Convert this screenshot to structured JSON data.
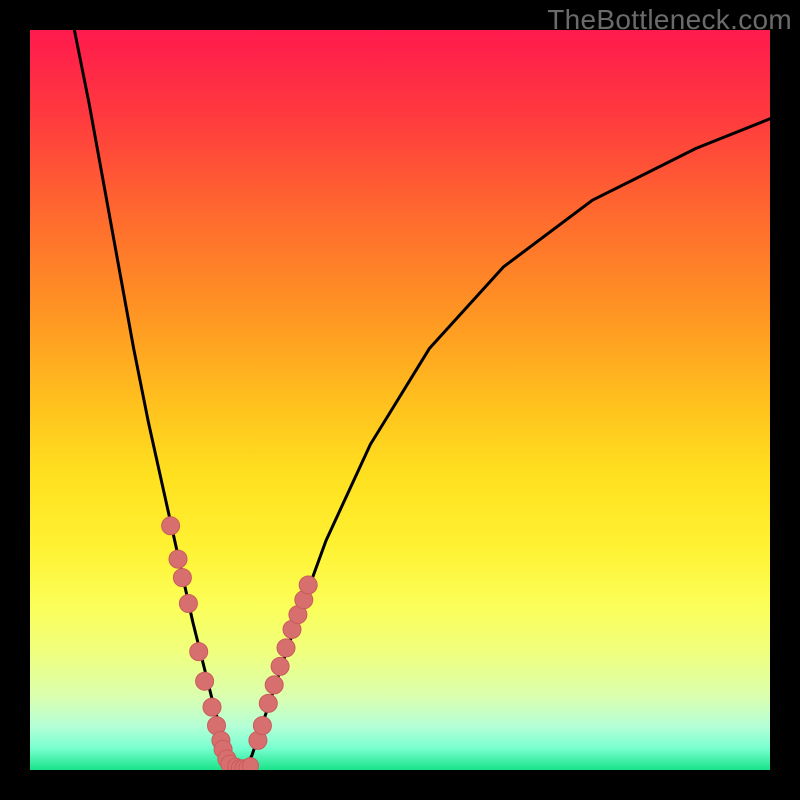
{
  "watermark": "TheBottleneck.com",
  "chart_data": {
    "type": "line",
    "title": "",
    "xlabel": "",
    "ylabel": "",
    "xlim": [
      0,
      100
    ],
    "ylim": [
      0,
      100
    ],
    "curve": {
      "x": [
        6,
        8,
        10,
        12,
        14,
        16,
        18,
        20,
        22,
        23,
        24,
        25,
        26,
        27,
        28,
        29,
        30,
        31,
        33,
        36,
        40,
        46,
        54,
        64,
        76,
        90,
        100
      ],
      "y": [
        100,
        90,
        79,
        68,
        57,
        47,
        38,
        29,
        20,
        16,
        12,
        8,
        5,
        2,
        0,
        0,
        2,
        5,
        11,
        20,
        31,
        44,
        57,
        68,
        77,
        84,
        88
      ]
    },
    "scatter_left": {
      "x": [
        19.0,
        20.0,
        20.6,
        21.4,
        22.8,
        23.6,
        24.6,
        25.2,
        25.8,
        26.1,
        26.6,
        27.0
      ],
      "y": [
        33.0,
        28.5,
        26.0,
        22.5,
        16.0,
        12.0,
        8.5,
        6.0,
        4.0,
        2.8,
        1.5,
        0.8
      ]
    },
    "scatter_right": {
      "x": [
        30.8,
        31.4,
        32.2,
        33.0,
        33.8,
        34.6,
        35.4,
        36.2,
        37.0,
        37.6
      ],
      "y": [
        4.0,
        6.0,
        9.0,
        11.5,
        14.0,
        16.5,
        19.0,
        21.0,
        23.0,
        25.0
      ]
    },
    "scatter_bottom": {
      "x": [
        27.8,
        28.3,
        28.8,
        29.3,
        29.8
      ],
      "y": [
        0.5,
        0.3,
        0.3,
        0.3,
        0.6
      ]
    },
    "colors": {
      "curve": "#000000",
      "markers_fill": "#d86f6f",
      "markers_stroke": "#c95b5b"
    }
  }
}
